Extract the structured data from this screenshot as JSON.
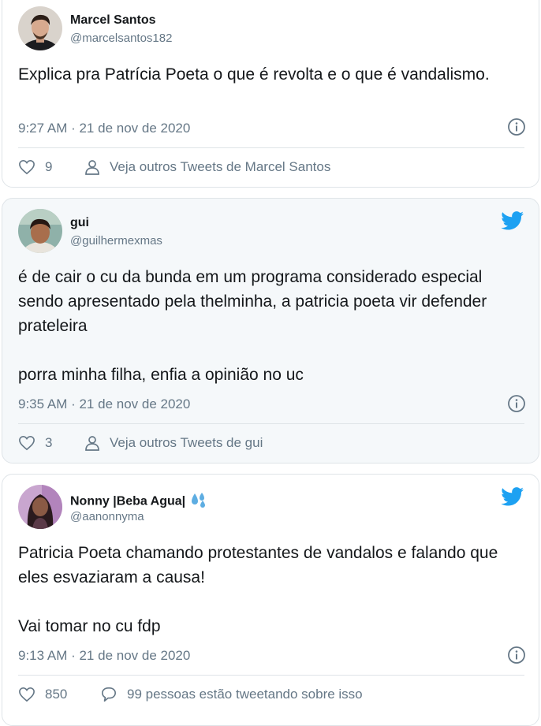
{
  "tweets": [
    {
      "name": "Marcel Santos",
      "handle": "@marcelsantos182",
      "text": "Explica pra Patrícia Poeta o que é revolta e o que é vandalismo.",
      "timestamp": "9:27 AM · 21 de nov de 2020",
      "likes": "9",
      "secondary_action": "Veja outros Tweets de Marcel Santos",
      "show_bird": false,
      "bird_color": "#1da1f2"
    },
    {
      "name": "gui",
      "handle": "@guilhermexmas",
      "text": "é de cair o cu da bunda em um programa considerado especial sendo apresentado pela thelminha, a patricia poeta vir defender prateleira\n\nporra minha filha, enfia a opinião no uc",
      "timestamp": "9:35 AM · 21 de nov de 2020",
      "likes": "3",
      "secondary_action": "Veja outros Tweets de gui",
      "show_bird": true
    },
    {
      "name": "Nonny |Beba Agua|",
      "name_emoji": "sweat-droplets-icon",
      "handle": "@aanonnyma",
      "text": "Patricia Poeta chamando protestantes de vandalos e falando que eles esvaziaram a causa!\n\nVai tomar no cu fdp",
      "timestamp": "9:13 AM · 21 de nov de 2020",
      "likes": "850",
      "secondary_action": "99 pessoas estão tweetando sobre isso",
      "show_bird": true
    }
  ],
  "colors": {
    "accent": "#1da1f2",
    "muted": "#657786",
    "text": "#14171a",
    "border": "#dfe4e8",
    "alt_bg": "#f5f8fa"
  }
}
